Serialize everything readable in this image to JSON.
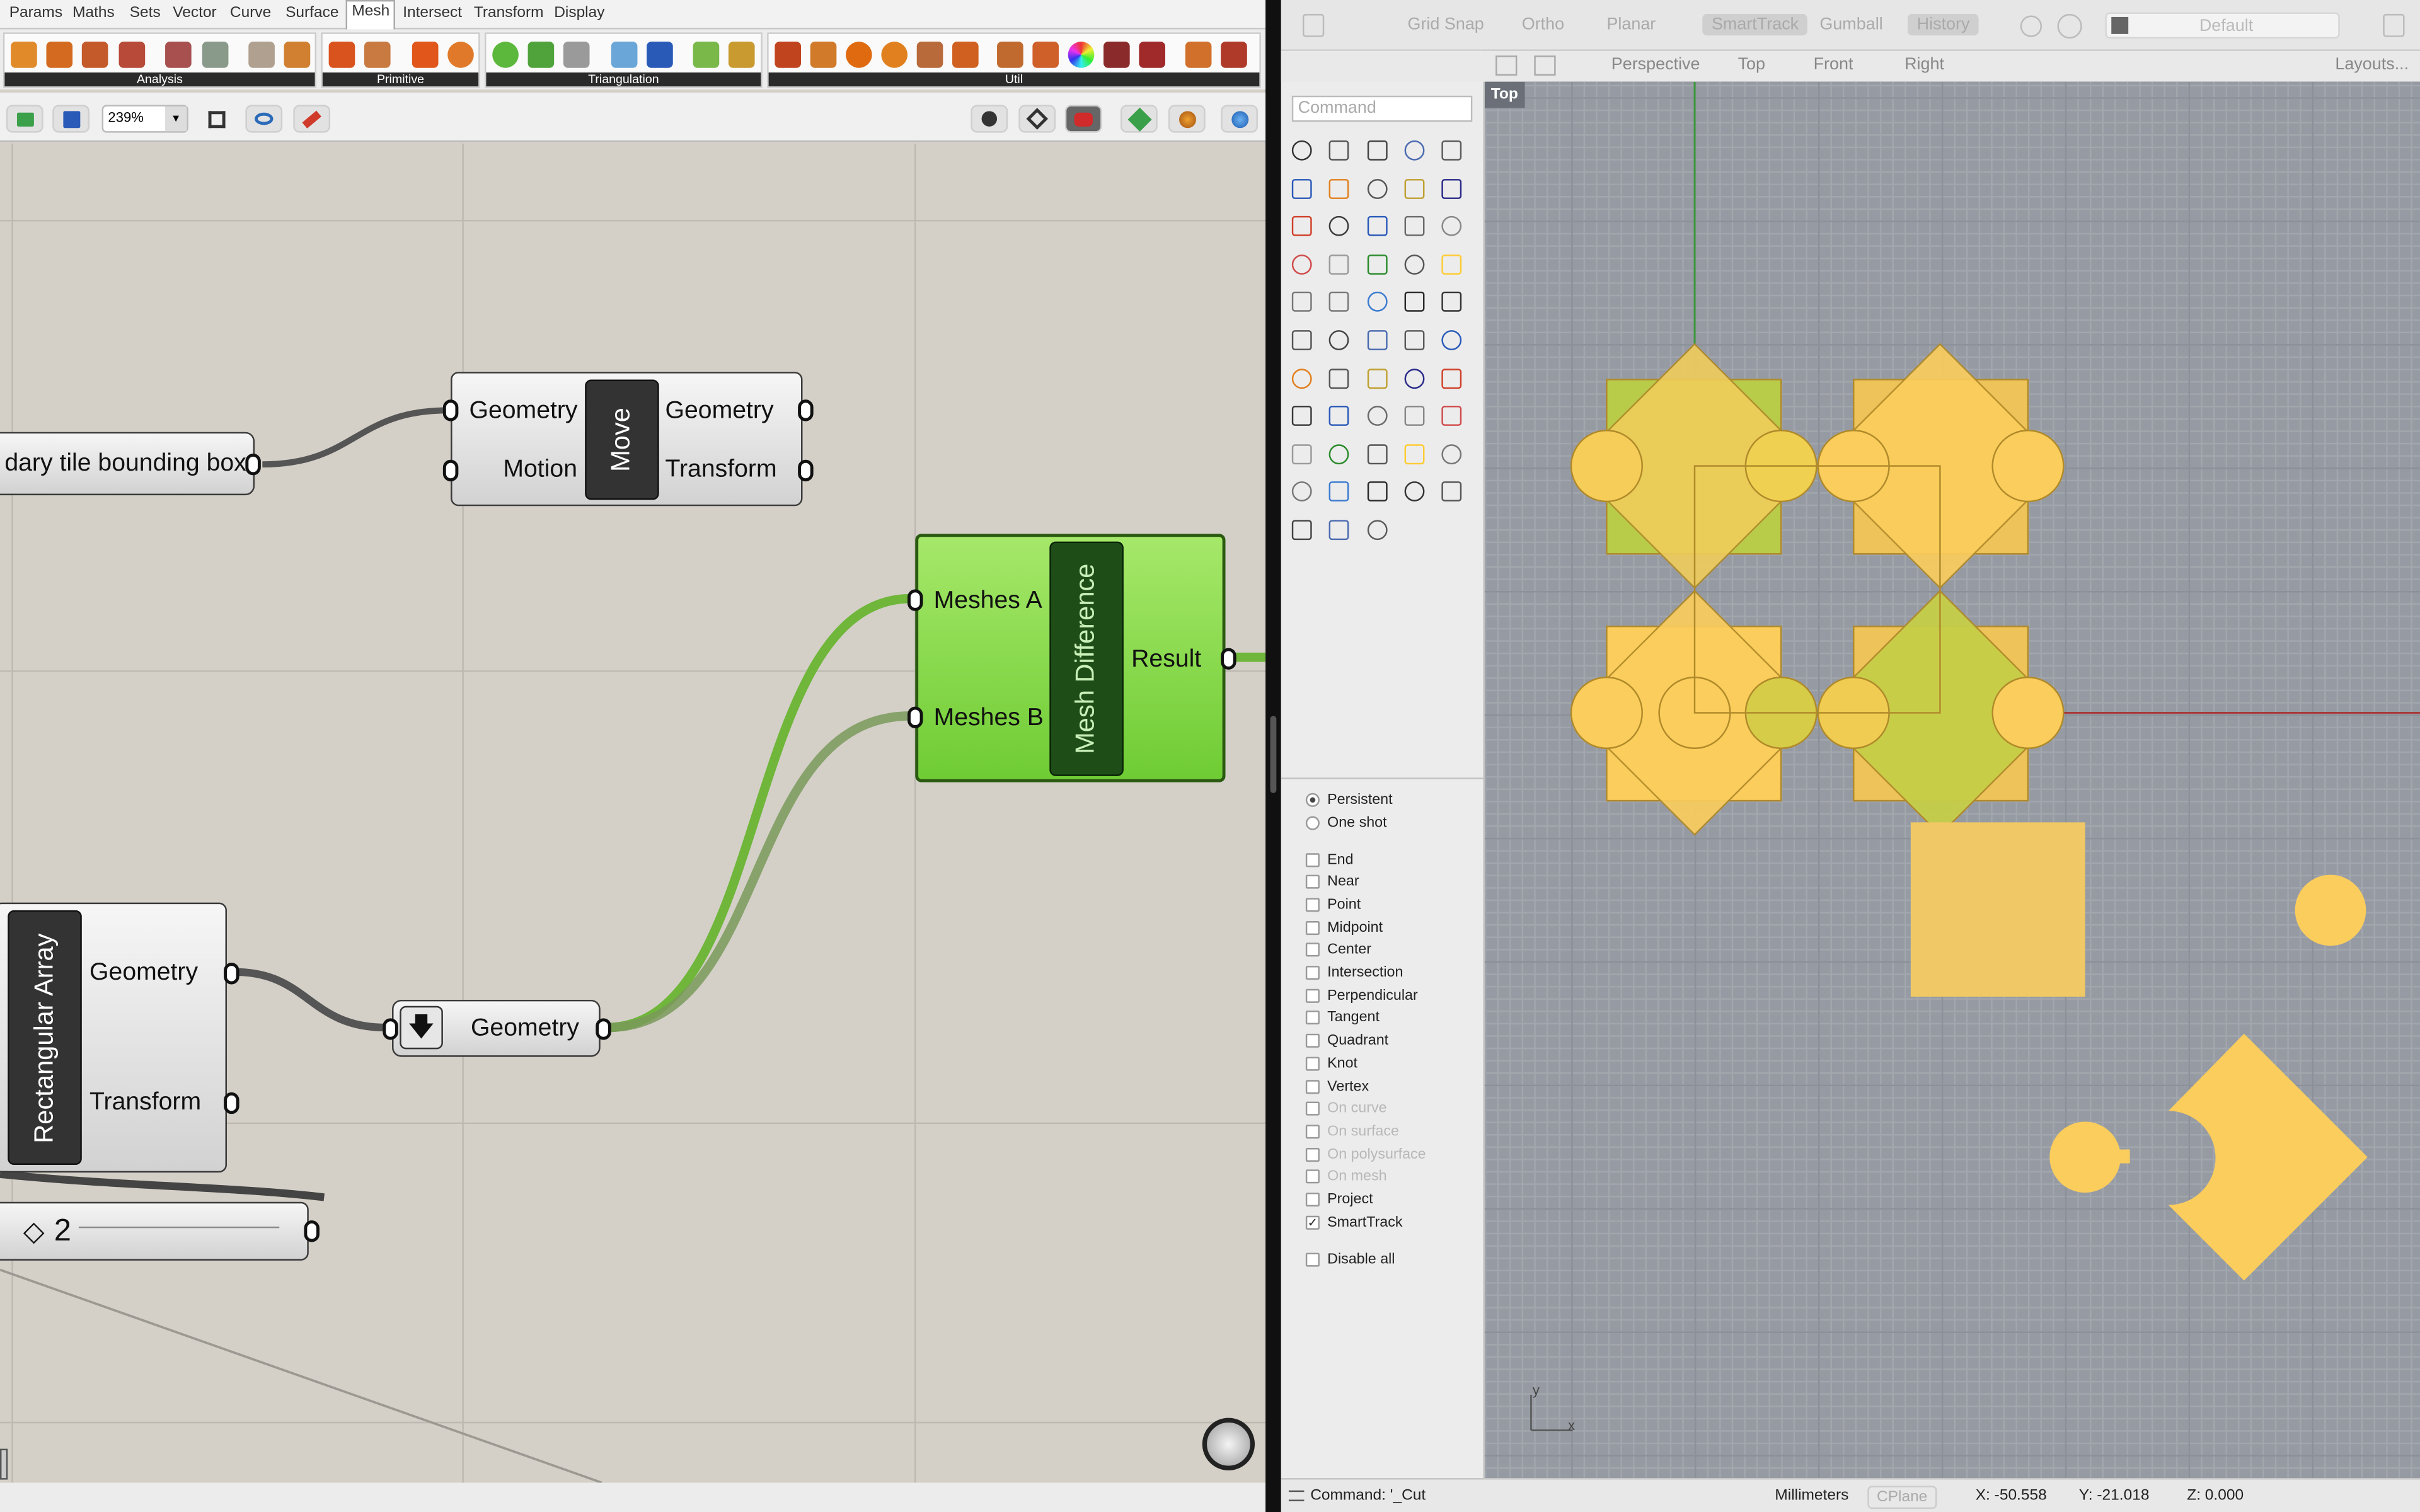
{
  "grasshopper": {
    "menu_tabs": [
      "Params",
      "Maths",
      "Sets",
      "Vector",
      "Curve",
      "Surface",
      "Mesh",
      "Intersect",
      "Transform",
      "Display"
    ],
    "active_tab": "Mesh",
    "ribbon_groups": [
      "Analysis",
      "Primitive",
      "Triangulation",
      "Util"
    ],
    "zoom_level": "239%",
    "components": {
      "boundary_param": {
        "label": "dary tile bounding box"
      },
      "move": {
        "caption": "Move",
        "inputs": [
          "Geometry",
          "Motion"
        ],
        "outputs": [
          "Geometry",
          "Transform"
        ]
      },
      "mesh_difference": {
        "caption": "Mesh Difference",
        "inputs": [
          "Meshes A",
          "Meshes B"
        ],
        "outputs": [
          "Result"
        ]
      },
      "rectangular_array": {
        "caption": "Rectangular Array",
        "outputs": [
          "Geometry",
          "Transform"
        ]
      },
      "geometry_param": {
        "label": "Geometry"
      },
      "slider": {
        "value": "2",
        "glyph": "◇"
      }
    }
  },
  "rhino": {
    "toggles": [
      "Grid Snap",
      "Ortho",
      "Planar",
      "SmartTrack",
      "Gumball",
      "History"
    ],
    "toggles_on": [
      "SmartTrack",
      "History"
    ],
    "layer": "Default",
    "viewport_tabs": [
      "Perspective",
      "Top",
      "Front",
      "Right"
    ],
    "active_viewport": "Perspective",
    "layouts_label": "Layouts...",
    "viewport_label": "Top",
    "command_placeholder": "Command",
    "osnap_mode": [
      "Persistent",
      "One shot"
    ],
    "osnap_mode_selected": "Persistent",
    "osnaps": [
      {
        "label": "End",
        "checked": false,
        "disabled": false
      },
      {
        "label": "Near",
        "checked": false,
        "disabled": false
      },
      {
        "label": "Point",
        "checked": false,
        "disabled": false
      },
      {
        "label": "Midpoint",
        "checked": false,
        "disabled": false
      },
      {
        "label": "Center",
        "checked": false,
        "disabled": false
      },
      {
        "label": "Intersection",
        "checked": false,
        "disabled": false
      },
      {
        "label": "Perpendicular",
        "checked": false,
        "disabled": false
      },
      {
        "label": "Tangent",
        "checked": false,
        "disabled": false
      },
      {
        "label": "Quadrant",
        "checked": false,
        "disabled": false
      },
      {
        "label": "Knot",
        "checked": false,
        "disabled": false
      },
      {
        "label": "Vertex",
        "checked": false,
        "disabled": false
      },
      {
        "label": "On curve",
        "checked": false,
        "disabled": true
      },
      {
        "label": "On surface",
        "checked": false,
        "disabled": true
      },
      {
        "label": "On polysurface",
        "checked": false,
        "disabled": true
      },
      {
        "label": "On mesh",
        "checked": false,
        "disabled": true
      },
      {
        "label": "Project",
        "checked": false,
        "disabled": false
      },
      {
        "label": "SmartTrack",
        "checked": true,
        "disabled": false
      }
    ],
    "disable_all_label": "Disable all",
    "check_mark": "✓",
    "status": {
      "command": "Command: '_Cut",
      "units": "Millimeters",
      "cplane": "CPlane",
      "x": "X: -50.558",
      "y": "Y: -21.018",
      "z": "Z: 0.000"
    },
    "axis_labels": {
      "x": "x",
      "y": "y"
    },
    "colors": {
      "tile_fill": "#fbcd5c",
      "tile_green": "#b9cc4a",
      "viewport_bg": "#969ba3",
      "wire_green": "#6fb63a"
    }
  }
}
